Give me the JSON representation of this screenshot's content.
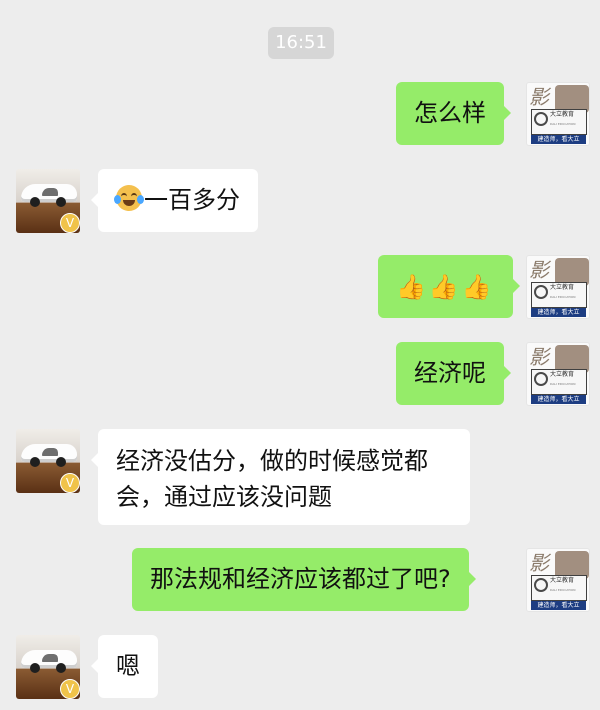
{
  "chat": {
    "timestamp": "16:51",
    "avatar_me": {
      "logo_name": "大立教育",
      "logo_sub": "DALI EDUCATION",
      "slogan": "建造师，看大立"
    },
    "messages": [
      {
        "from": "me",
        "text": "怎么样"
      },
      {
        "from": "other",
        "emoji": "face-with-tears-of-joy",
        "text": "一百多分"
      },
      {
        "from": "me",
        "emoji": "thumbs-up",
        "emoji_count": 3,
        "text": ""
      },
      {
        "from": "me",
        "text": "经济呢"
      },
      {
        "from": "other",
        "lines": [
          "经济没估分，做的时候感觉都",
          "会，通过应该没问题"
        ]
      },
      {
        "from": "me",
        "text": "那法规和经济应该都过了吧?"
      },
      {
        "from": "other",
        "text": "嗯"
      }
    ],
    "thumbs_glyph": "👍",
    "badge_letter": "V",
    "colors": {
      "background": "#ededed",
      "sent_bubble": "#95ec69",
      "received_bubble": "#ffffff",
      "time_pill": "#d6d6d6"
    }
  }
}
